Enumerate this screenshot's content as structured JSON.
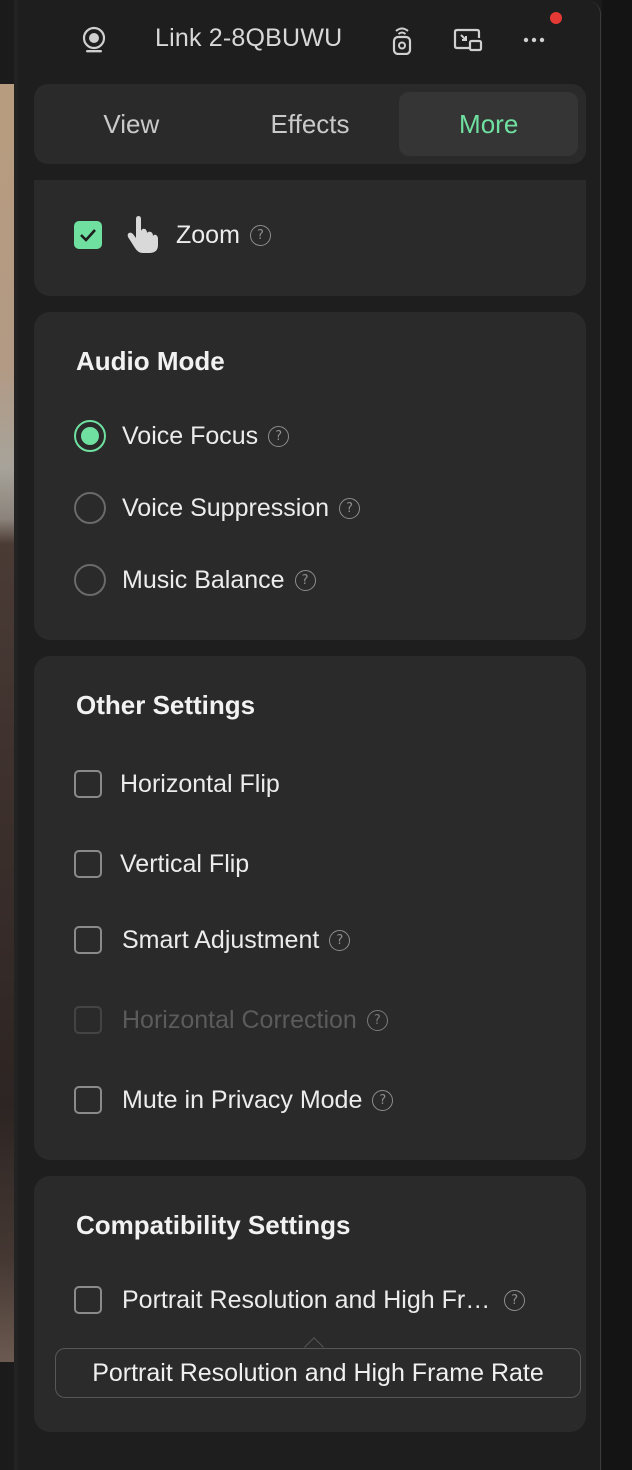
{
  "header": {
    "device_name": "Link 2-8QBUWU",
    "icons": [
      "webcam-icon",
      "remote-control-icon",
      "picture-in-picture-icon",
      "more-options-icon"
    ]
  },
  "tabs": [
    {
      "label": "View",
      "active": false
    },
    {
      "label": "Effects",
      "active": false
    },
    {
      "label": "More",
      "active": true
    }
  ],
  "gesture": {
    "label": "Zoom",
    "checked": true
  },
  "audio_mode": {
    "title": "Audio Mode",
    "options": [
      {
        "label": "Voice Focus",
        "selected": true
      },
      {
        "label": "Voice Suppression",
        "selected": false
      },
      {
        "label": "Music Balance",
        "selected": false
      }
    ]
  },
  "other_settings": {
    "title": "Other Settings",
    "options": [
      {
        "label": "Horizontal Flip",
        "checked": false
      },
      {
        "label": "Vertical Flip",
        "checked": false
      },
      {
        "label": "Smart Adjustment",
        "checked": false
      },
      {
        "label": "Horizontal Correction",
        "checked": false,
        "disabled": true
      },
      {
        "label": "Mute in Privacy Mode",
        "checked": false
      }
    ]
  },
  "compatibility": {
    "title": "Compatibility Settings",
    "option_label": "Portrait Resolution and High Fr…",
    "tooltip": "Portrait Resolution and High Frame Rate"
  },
  "colors": {
    "accent": "#6fe0a0",
    "panel": "#2a2a2a",
    "notification": "#e53935"
  }
}
